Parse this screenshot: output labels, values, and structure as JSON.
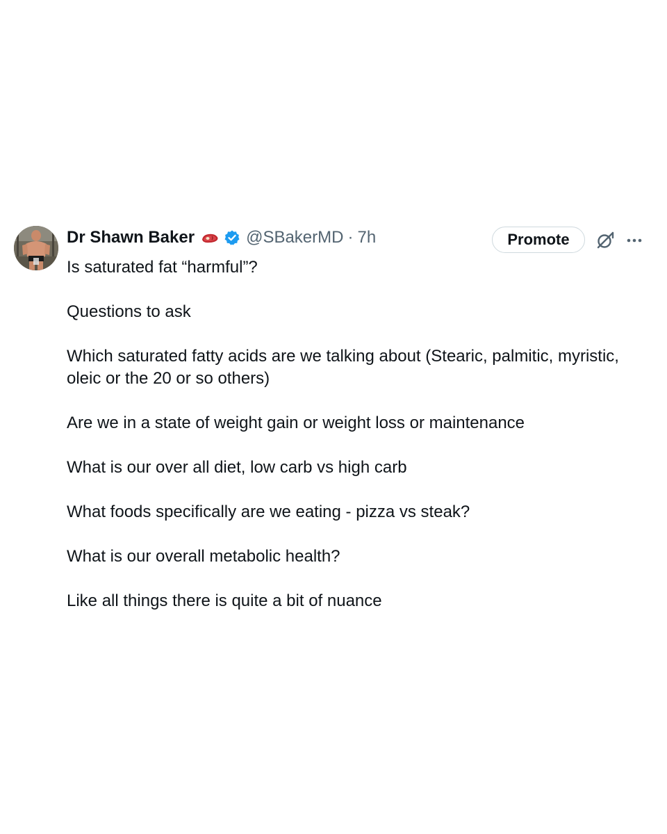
{
  "tweet": {
    "author": {
      "name": "Dr Shawn Baker",
      "handle": "@SBakerMD",
      "separator": "·",
      "time": "7h",
      "avatar_icon": "profile-photo",
      "emoji_icon": "steak-icon",
      "badge_icon": "verified-badge-icon",
      "badge_color": "#1d9bf0"
    },
    "actions": {
      "promote_label": "Promote",
      "grok_icon": "grok-icon",
      "more_icon": "more-options-icon"
    },
    "paragraphs": [
      "Is saturated fat “harmful”?",
      "Questions to ask",
      "Which saturated fatty acids are we talking about (Stearic, palmitic, myristic, oleic or the 20 or so others)",
      "Are we in a state of weight gain or weight loss or maintenance",
      "What is our over all diet, low carb vs high carb",
      "What foods specifically are we eating - pizza vs steak?",
      "What is our overall metabolic health?",
      "Like all things there is quite a bit of nuance"
    ]
  }
}
